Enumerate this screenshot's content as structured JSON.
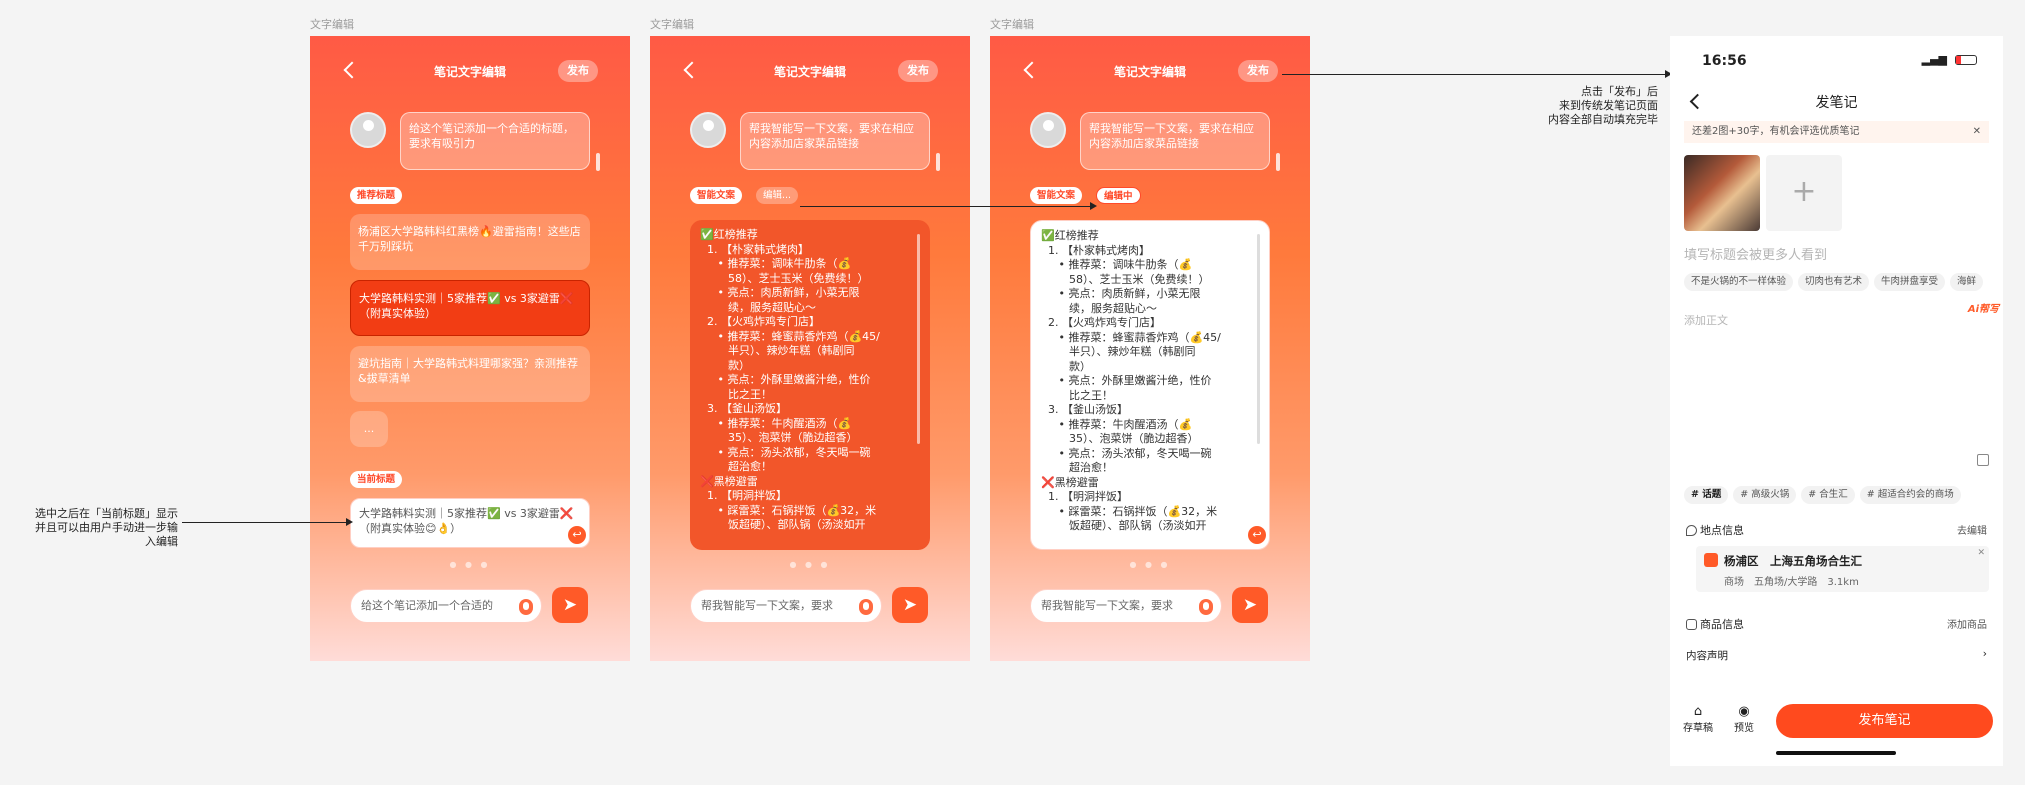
{
  "frames": [
    {
      "label": "文字编辑",
      "title": "笔记文字编辑",
      "publish": "发布",
      "prompt": "给这个笔记添加一个合适的标题，要求有吸引力",
      "recommend_tag": "推荐标题",
      "options": [
        "杨浦区大学路韩料红黑榜🔥避雷指南！这些店千万别踩坑",
        "大学路韩料实测｜5家推荐✅ vs 3家避雷❌（附真实体验）",
        "避坑指南｜大学路韩式料理哪家强？亲测推荐&拔草清单",
        "..."
      ],
      "current_tag": "当前标题",
      "current_text": "大学路韩料实测｜5家推荐✅ vs 3家避雷❌（附真实体验😊👌）",
      "dots": "● ● ●",
      "input_text": "给这个笔记添加一个合适的",
      "send_icon": "send-icon"
    },
    {
      "label": "文字编辑",
      "title": "笔记文字编辑",
      "publish": "发布",
      "prompt": "帮我智能写一下文案，要求在相应内容添加店家菜品链接",
      "tag1": "智能文案",
      "tag2": "编辑...",
      "lines": [
        "✅红榜推荐",
        "  1. 【朴家韩式烤肉】",
        "     • 推荐菜：调味牛肋条（💰",
        "        58）、芝士玉米（免费续！）",
        "     • 亮点：肉质新鲜，小菜无限",
        "        续，服务超贴心〜",
        "  2. 【火鸡炸鸡专门店】",
        "     • 推荐菜：蜂蜜蒜香炸鸡（💰45/",
        "        半只）、辣炒年糕（韩剧同",
        "        款）",
        "     • 亮点：外酥里嫩酱汁绝，性价",
        "        比之王！",
        "  3. 【釜山汤饭】",
        "     • 推荐菜：牛肉醒酒汤（💰",
        "        35）、泡菜饼（脆边超香）",
        "     • 亮点：汤头浓郁，冬天喝一碗",
        "        超治愈！",
        "❌黑榜避雷",
        "  1. 【明洞拌饭】",
        "     • 踩雷菜：石锅拌饭（💰32，米",
        "        饭超硬）、部队锅（汤淡如开"
      ],
      "dots": "● ● ●",
      "input_text": "帮我智能写一下文案，要求",
      "send_icon": "send-icon"
    },
    {
      "label": "文字编辑",
      "title": "笔记文字编辑",
      "publish": "发布",
      "prompt": "帮我智能写一下文案，要求在相应内容添加店家菜品链接",
      "tag1": "智能文案",
      "tag2": "编辑中",
      "lines": [
        "✅红榜推荐",
        "  1. 【朴家韩式烤肉】",
        "     • 推荐菜：调味牛肋条（💰",
        "        58）、芝士玉米（免费续！）",
        "     • 亮点：肉质新鲜，小菜无限",
        "        续，服务超贴心〜",
        "  2. 【火鸡炸鸡专门店】",
        "     • 推荐菜：蜂蜜蒜香炸鸡（💰45/",
        "        半只）、辣炒年糕（韩剧同",
        "        款）",
        "     • 亮点：外酥里嫩酱汁绝，性价",
        "        比之王！",
        "  3. 【釜山汤饭】",
        "     • 推荐菜：牛肉醒酒汤（💰",
        "        35）、泡菜饼（脆边超香）",
        "     • 亮点：汤头浓郁，冬天喝一碗",
        "        超治愈！",
        "❌黑榜避雷",
        "  1. 【明洞拌饭】",
        "     • 踩雷菜：石锅拌饭（💰32，米",
        "        饭超硬）、部队锅（汤淡如开"
      ],
      "dots": "● ● ●",
      "input_text": "帮我智能写一下文案，要求",
      "send_icon": "send-icon"
    }
  ],
  "annotations": {
    "left": [
      "选中之后在「当前标题」显示",
      "并且可以由用户手动进一步输",
      "入编辑"
    ],
    "right": [
      "点击「发布」后",
      "来到传统发笔记页面",
      "内容全部自动填充完毕"
    ]
  },
  "post_page": {
    "time": "16:56",
    "title": "发笔记",
    "tip": "还差2图+30字，有机会评选优质笔记",
    "title_placeholder": "填写标题会被更多人看到",
    "suggest_chips": [
      "不是火锅的不一样体验",
      "切肉也有艺术",
      "牛肉拼盘享受",
      "海鲜"
    ],
    "ai_badge": "Ai帮写",
    "body_placeholder": "添加正文",
    "topic_chips": [
      "# 话题",
      "# 高级火锅",
      "# 合生汇",
      "# 超适合约会的商场"
    ],
    "location_label": "地点信息",
    "location_action": "去编辑",
    "location_name": "杨浦区　上海五角场合生汇",
    "location_sub": "商场　五角场/大学路　3.1km",
    "goods_label": "商品信息",
    "goods_action": "添加商品",
    "declare_label": "内容声明",
    "draft_label": "存草稿",
    "preview_label": "预览",
    "publish_button": "发布笔记"
  },
  "colors": {
    "brand": "#ff5a28",
    "highlight": "#4a8fff"
  }
}
